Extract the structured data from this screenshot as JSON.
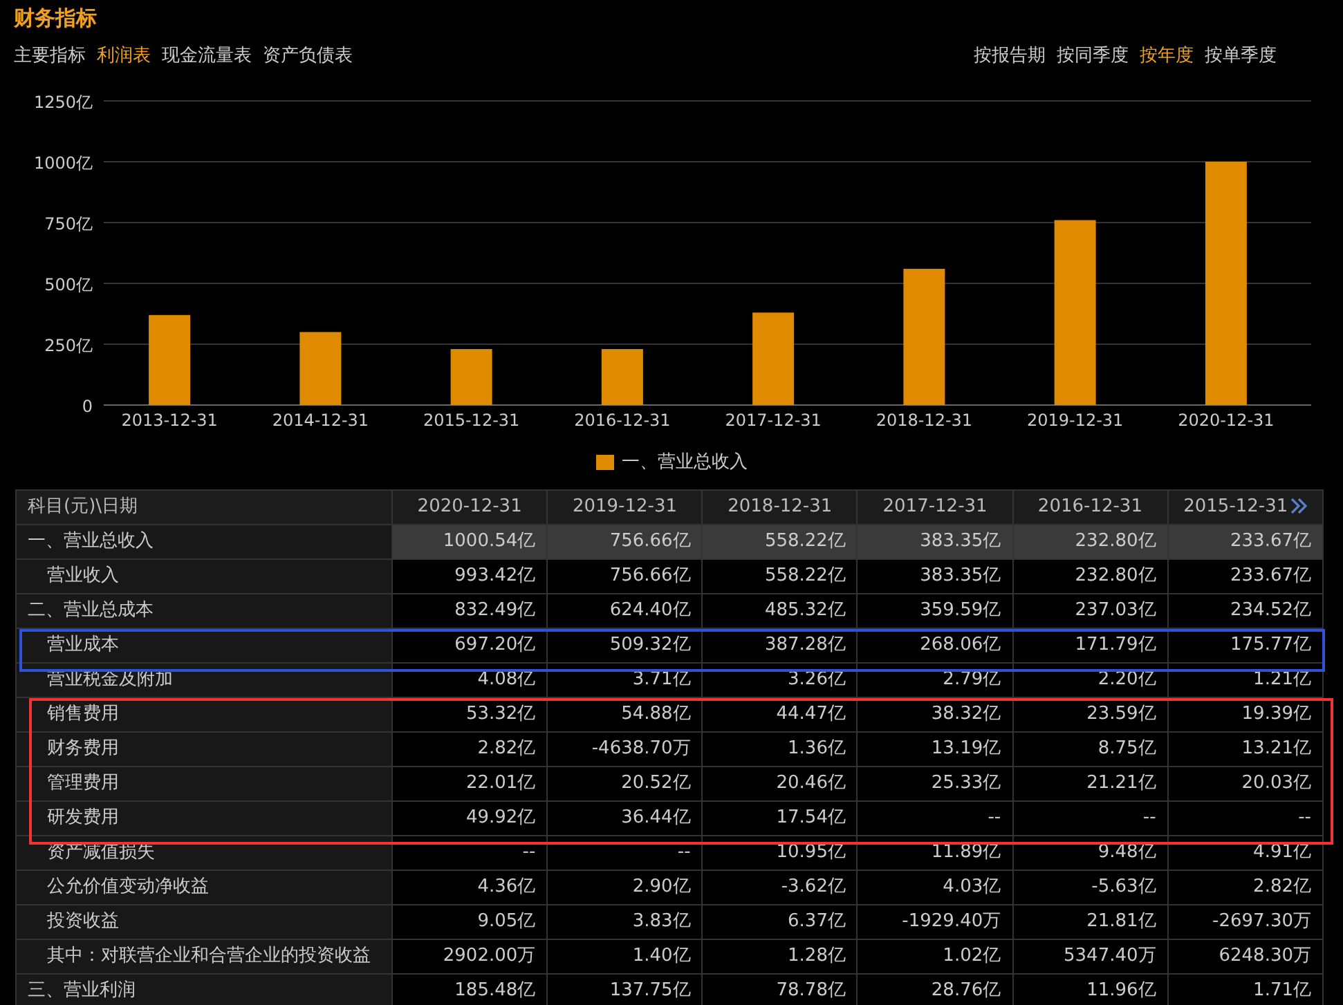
{
  "title": "财务指标",
  "tabs": [
    {
      "label": "主要指标",
      "selected": false
    },
    {
      "label": "利润表",
      "selected": true
    },
    {
      "label": "现金流量表",
      "selected": false
    },
    {
      "label": "资产负债表",
      "selected": false
    }
  ],
  "periods": [
    {
      "label": "按报告期",
      "selected": false
    },
    {
      "label": "按同季度",
      "selected": false
    },
    {
      "label": "按年度",
      "selected": true
    },
    {
      "label": "按单季度",
      "selected": false
    }
  ],
  "chart_data": {
    "type": "bar",
    "categories": [
      "2013-12-31",
      "2014-12-31",
      "2015-12-31",
      "2016-12-31",
      "2017-12-31",
      "2018-12-31",
      "2019-12-31",
      "2020-12-31"
    ],
    "grid": true,
    "series": [
      {
        "name": "一、营业总收入",
        "color": "#e08a00",
        "values": [
          370,
          300,
          230,
          230,
          380,
          560,
          760,
          1000
        ]
      }
    ],
    "ylim": [
      0,
      1250
    ],
    "yticks": [
      {
        "value": 0,
        "label": "0"
      },
      {
        "value": 250,
        "label": "250亿"
      },
      {
        "value": 500,
        "label": "500亿"
      },
      {
        "value": 750,
        "label": "750亿"
      },
      {
        "value": 1000,
        "label": "1000亿"
      },
      {
        "value": 1250,
        "label": "1250亿"
      }
    ]
  },
  "table": {
    "corner_header": "科目(元)\\日期",
    "columns": [
      "2020-12-31",
      "2019-12-31",
      "2018-12-31",
      "2017-12-31",
      "2016-12-31",
      "2015-12-31"
    ],
    "rows": [
      {
        "label": "一、营业总收入",
        "selected": true,
        "cells": [
          "1000.54亿",
          "756.66亿",
          "558.22亿",
          "383.35亿",
          "232.80亿",
          "233.67亿"
        ],
        "children": [
          {
            "label": "营业收入",
            "selected": false,
            "cells": [
              "993.42亿",
              "756.66亿",
              "558.22亿",
              "383.35亿",
              "232.80亿",
              "233.67亿"
            ]
          }
        ]
      },
      {
        "label": "二、营业总成本",
        "selected": false,
        "cells": [
          "832.49亿",
          "624.40亿",
          "485.32亿",
          "359.59亿",
          "237.03亿",
          "234.52亿"
        ],
        "children": [
          {
            "label": "营业成本",
            "selected": false,
            "color": "#2f52d8",
            "cells": [
              "697.20亿",
              "509.32亿",
              "387.28亿",
              "268.06亿",
              "171.79亿",
              "175.77亿"
            ]
          },
          {
            "label": "营业税金及附加",
            "selected": false,
            "cells": [
              "4.08亿",
              "3.71亿",
              "3.26亿",
              "2.79亿",
              "2.20亿",
              "1.21亿"
            ]
          },
          {
            "label": "销售费用",
            "selected": false,
            "color": "#f03434",
            "cells": [
              "53.32亿",
              "54.88亿",
              "44.47亿",
              "38.32亿",
              "23.59亿",
              "19.39亿"
            ]
          },
          {
            "label": "财务费用",
            "selected": false,
            "color": "#f03434",
            "cells": [
              "2.82亿",
              "-4638.70万",
              "1.36亿",
              "13.19亿",
              "8.75亿",
              "13.21亿"
            ]
          },
          {
            "label": "管理费用",
            "selected": false,
            "color": "#f03434",
            "cells": [
              "22.01亿",
              "20.52亿",
              "20.46亿",
              "25.33亿",
              "21.21亿",
              "20.03亿"
            ]
          },
          {
            "label": "研发费用",
            "selected": false,
            "color": "#f03434",
            "cells": [
              "49.92亿",
              "36.44亿",
              "17.54亿",
              "--",
              "--",
              "--"
            ]
          },
          {
            "label": "资产减值损失",
            "selected": false,
            "cells": [
              "--",
              "--",
              "10.95亿",
              "11.89亿",
              "9.48亿",
              "4.91亿"
            ]
          },
          {
            "label": "公允价值变动净收益",
            "selected": false,
            "cells": [
              "4.36亿",
              "2.90亿",
              "-3.62亿",
              "4.03亿",
              "-5.63亿",
              "2.82亿"
            ]
          },
          {
            "label": "投资收益",
            "selected": false,
            "cells": [
              "9.05亿",
              "3.83亿",
              "6.37亿",
              "-1929.40万",
              "21.81亿",
              "-2697.30万"
            ]
          },
          {
            "label": "其中：对联营企业和合营企业的投资收益",
            "selected": false,
            "cells": [
              "2902.00万",
              "1.40亿",
              "1.28亿",
              "1.02亿",
              "5347.40万",
              "6248.30万"
            ]
          }
        ]
      },
      {
        "label": "三、营业利润",
        "selected": false,
        "cells": [
          "185.48亿",
          "137.75亿",
          "78.78亿",
          "28.76亿",
          "11.96亿",
          "1.71亿"
        ]
      }
    ]
  }
}
